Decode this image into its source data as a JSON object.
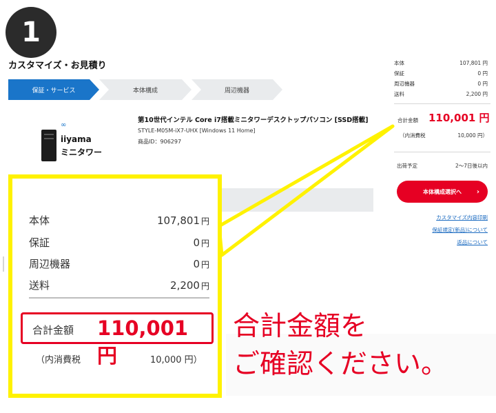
{
  "step_marker": "1",
  "page_title": "カスタマイズ・お見積り",
  "stepper": {
    "steps": [
      {
        "label": "保証・サービス",
        "active": true
      },
      {
        "label": "本体構成",
        "active": false
      },
      {
        "label": "周辺機器",
        "active": false
      }
    ]
  },
  "product": {
    "brand": "iiyama",
    "line": "ミニタワー",
    "name": "第10世代インテル Core i7搭載ミニタワーデスクトップパソコン [SSD搭載]",
    "model": "STYLE-M05M-iX7-UHX [Windows 11 Home]",
    "product_id": "商品ID：906297"
  },
  "sidebar": {
    "rows": [
      {
        "label": "本体",
        "value": "107,801 円"
      },
      {
        "label": "保証",
        "value": "0 円"
      },
      {
        "label": "周辺機器",
        "value": "0 円"
      },
      {
        "label": "送料",
        "value": "2,200 円"
      }
    ],
    "total_label": "合計金額",
    "total_value": "110,001 円",
    "tax_label": "（内消費税",
    "tax_value": "10,000 円）",
    "ship_label": "出荷予定",
    "ship_value": "2～7日後以内",
    "next_button": "本体構成選択へ",
    "next_arrow": "›",
    "links": [
      "カスタマイズ内容印刷",
      "保証規定(新品)について",
      "返品について"
    ]
  },
  "zoom": {
    "rows": [
      {
        "label": "本体",
        "amount": "107,801",
        "unit": "円"
      },
      {
        "label": "保証",
        "amount": "0",
        "unit": "円"
      },
      {
        "label": "周辺機器",
        "amount": "0",
        "unit": "円"
      },
      {
        "label": "送料",
        "amount": "2,200",
        "unit": "円"
      }
    ],
    "total_label": "合計金額",
    "total_value": "110,001 円",
    "tax_label": "（内消費税",
    "tax_value": "10,000 円）"
  },
  "message": {
    "line1": "合計金額を",
    "line2": "ご確認ください。"
  },
  "colors": {
    "accent_blue": "#1a75c9",
    "price_red": "#e60023",
    "highlight_yellow": "#fff200"
  }
}
